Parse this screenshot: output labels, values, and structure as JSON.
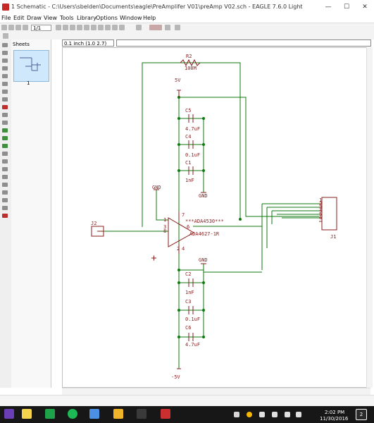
{
  "window": {
    "title": "1 Schematic - C:\\Users\\sbelden\\Documents\\eagle\\PreAmplifer V01\\preAmp V02.sch - EAGLE 7.6.0 Light",
    "minimize": "—",
    "maximize": "☐",
    "close": "✕"
  },
  "menu": [
    "File",
    "Edit",
    "Draw",
    "View",
    "Tools",
    "Library",
    "Options",
    "Window",
    "Help"
  ],
  "toolbar": {
    "sheet_value": "1/1"
  },
  "sheets": {
    "header": "Sheets",
    "label": "1"
  },
  "coordinates": {
    "value": "0.1 inch (1.0 2.7)"
  },
  "schematic": {
    "labels": {
      "r2": "R2",
      "r2_value": "100M",
      "vplus": "5V",
      "c5": "C5",
      "c5_value": "4.7uF",
      "c4": "C4",
      "c4_value": "0.1uF",
      "c1": "C1",
      "c1_value": "1nF",
      "gnd_top": "GND",
      "gnd_left": "GND",
      "j2": "J2",
      "amp_top": "***ADA4530***",
      "amp_bottom": "ADA4627-1R",
      "gnd_mid": "GND",
      "c2": "C2",
      "c2_value": "1nF",
      "c3": "C3",
      "c3_value": "0.1uF",
      "c6": "C6",
      "c6_value": "4.7uF",
      "vminus": "-5V",
      "j1": "J1",
      "pin1": "1",
      "pin2": "2",
      "pin3": "3",
      "pin4": "4",
      "pin5": "5",
      "pin6": "6",
      "op_pin1": "1",
      "op_pin3": "3",
      "op_pin8": "8",
      "op_pin7": "7",
      "op_pin6": "6",
      "op_pin4": "4",
      "op_pin2": "2"
    }
  },
  "taskbar": {
    "time": "2:02 PM",
    "date": "11/30/2016",
    "notifications": "2"
  }
}
